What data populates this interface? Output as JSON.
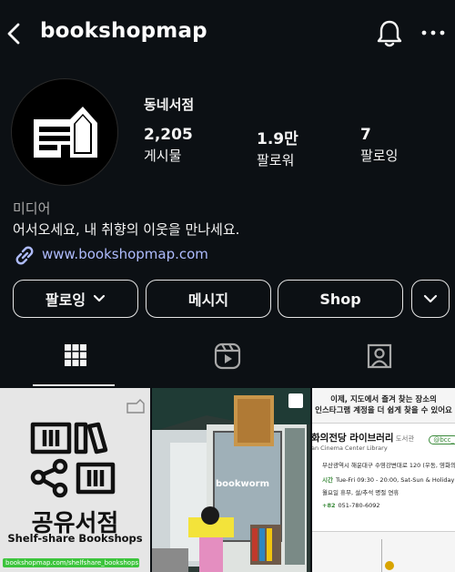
{
  "header": {
    "username": "bookshopmap",
    "icons": {
      "back": "chevron-left-icon",
      "notifications": "bell-icon",
      "more": "more-horizontal-icon"
    }
  },
  "profile": {
    "name": "동네서점",
    "stats": [
      {
        "value": "2,205",
        "label": "게시물"
      },
      {
        "value": "1.9만",
        "label": "팔로워"
      },
      {
        "value": "7",
        "label": "팔로잉"
      }
    ],
    "category": "미디어",
    "bio": "어서오세요, 내 취향의 이웃을 만나세요.",
    "link": "www.bookshopmap.com"
  },
  "actions": {
    "following_label": "팔로잉",
    "message_label": "메시지",
    "shop_label": "Shop"
  },
  "tabs": [
    {
      "name": "posts-grid",
      "icon": "grid-icon",
      "active": true
    },
    {
      "name": "reels",
      "icon": "reels-icon",
      "active": false
    },
    {
      "name": "tagged",
      "icon": "tagged-person-icon",
      "active": false
    }
  ],
  "posts": {
    "post1": {
      "title": "공유서점",
      "subtitle": "Shelf-share Bookshops",
      "url": "bookshopmap.com/shelfshare_bookshops"
    },
    "post2": {
      "sign": "bookworm"
    },
    "post3": {
      "headline1": "이제, 지도에서 즐겨 찾는 장소의",
      "headline2": "인스타그램 계정을 더 쉽게 찾을 수 있어요",
      "place_title": "화의전당 라이브러리",
      "place_category": "도서관",
      "place_en": "an Cinema Center Library",
      "address": "부산광역시 해운대구 수영강변대로 120 (우동, 영화의전당)",
      "hours_label": "시간",
      "hours": "Tue-Fri 09:30 - 20:00, Sat-Sun & Holiday 09:00 -",
      "closed": "월요일 휴무, 설/추석 명절 연휴",
      "phone_prefix": "+82",
      "phone": "051-780-6092",
      "handle": "@bcc_"
    }
  },
  "colors": {
    "background": "#0c1014",
    "link": "#aebbfd",
    "green_bar": "#3cc43c"
  }
}
